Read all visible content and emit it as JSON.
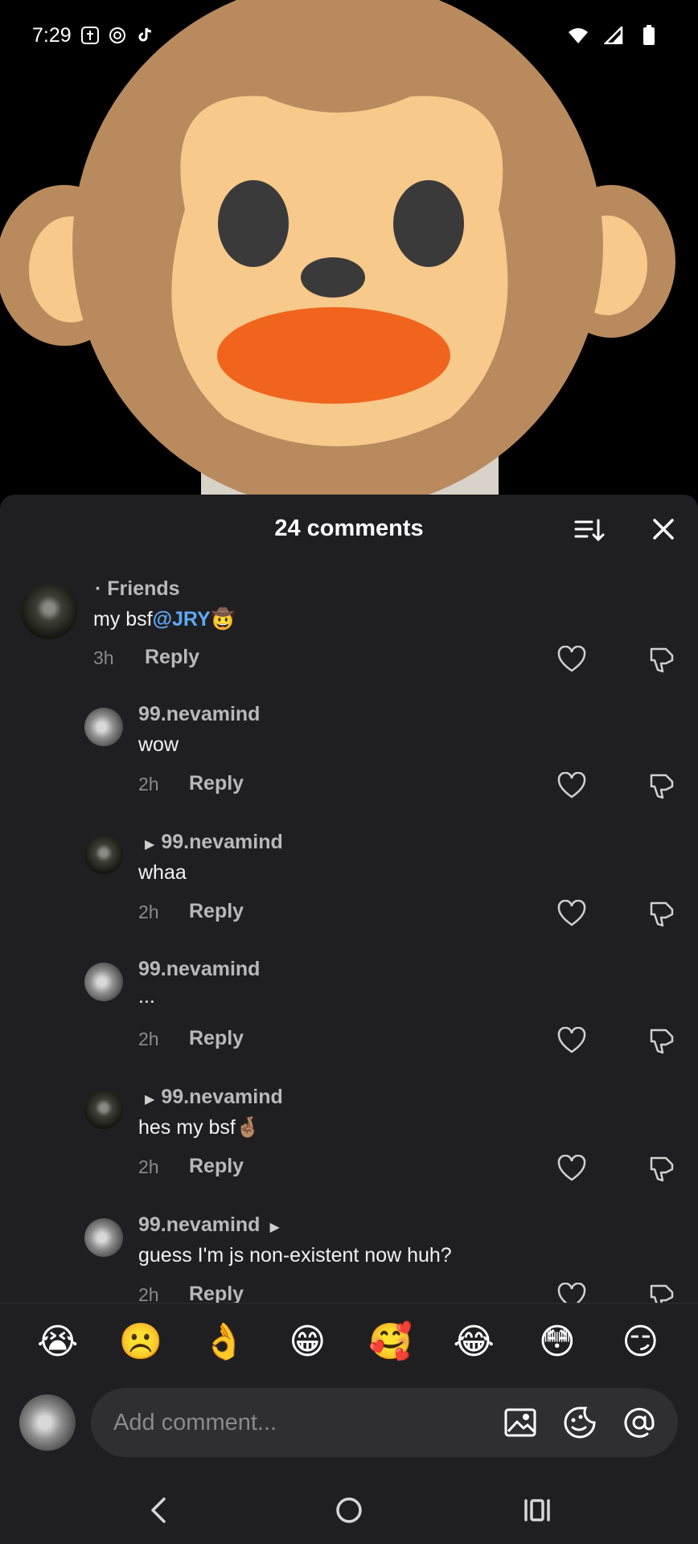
{
  "status": {
    "time": "7:29",
    "icons": [
      "shield-icon",
      "threads-icon",
      "tiktok-icon"
    ],
    "right_icons": [
      "wifi-icon",
      "signal-icon",
      "battery-icon"
    ]
  },
  "sheet": {
    "title": "24 comments"
  },
  "comments": [
    {
      "username": "",
      "friends_label": "· Friends",
      "text": "my bsf",
      "mention": "@JRY",
      "emoji": "🤠",
      "time": "3h",
      "reply": "Reply"
    },
    {
      "username": "99.nevamind",
      "text": "wow",
      "time": "2h",
      "reply": "Reply"
    },
    {
      "username": "99.nevamind",
      "text": "whaa",
      "time": "2h",
      "reply": "Reply"
    },
    {
      "username": "99.nevamind",
      "text": "...",
      "time": "2h",
      "reply": "Reply"
    },
    {
      "username": "99.nevamind",
      "text": "hes my bsf",
      "emoji": "🤞🏽",
      "time": "2h",
      "reply": "Reply"
    },
    {
      "username": "99.nevamind",
      "text": "guess I'm js non-existent now huh?",
      "time": "2h",
      "reply": "Reply"
    }
  ],
  "emoji_bar": [
    "😭",
    "☹️",
    "👌",
    "😁",
    "🥰",
    "😂",
    "😳",
    "😏"
  ],
  "composer": {
    "placeholder": "Add comment..."
  },
  "colors": {
    "sheet_bg": "#1f1f21",
    "mention": "#5fa8f5",
    "monkey_face": "#b88a5e",
    "monkey_inner": "#f7c98a",
    "monkey_mouth": "#f0641e"
  }
}
